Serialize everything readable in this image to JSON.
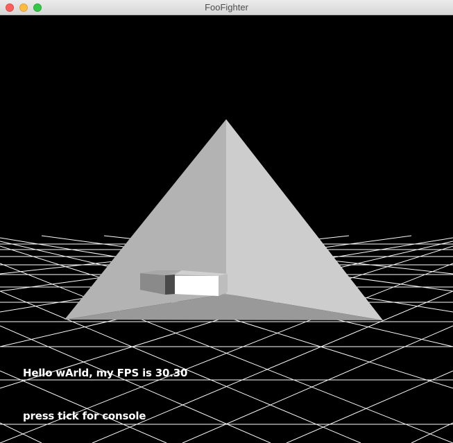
{
  "window": {
    "title": "FooFighter"
  },
  "hud": {
    "fps_text": "Hello wArld, my FPS is 30.30",
    "console_hint": "press tick for console"
  },
  "colors": {
    "background": "#000000",
    "grid": "#ffffff",
    "pyramid_left": "#b3b3b3",
    "pyramid_right": "#cccccc",
    "pyramid_floor": "#999999"
  }
}
